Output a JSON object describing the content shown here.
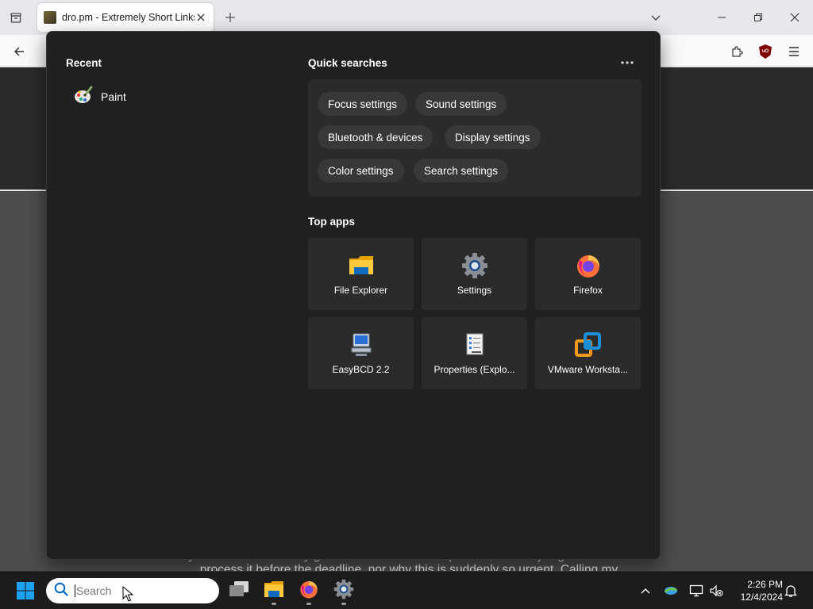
{
  "browser": {
    "tab_title": "dro.pm - Extremely Short Links"
  },
  "page": {
    "text_line1": "says: I do not know if my government will be so expedient, nor if my registrar can then",
    "text_line2": "process it before the deadline, nor why this is suddenly so urgent. Calling my"
  },
  "flyout": {
    "recent_heading": "Recent",
    "recent_items": [
      {
        "label": "Paint",
        "icon": "paint-icon"
      }
    ],
    "quick_heading": "Quick searches",
    "quick_searches": [
      "Focus settings",
      "Sound settings",
      "Bluetooth & devices",
      "Display settings",
      "Color settings",
      "Search settings"
    ],
    "top_apps_heading": "Top apps",
    "top_apps": [
      {
        "label": "File Explorer",
        "icon": "folder-icon"
      },
      {
        "label": "Settings",
        "icon": "gear-icon"
      },
      {
        "label": "Firefox",
        "icon": "firefox-icon"
      },
      {
        "label": "EasyBCD 2.2",
        "icon": "computer-icon"
      },
      {
        "label": "Properties (Explo...",
        "icon": "properties-icon"
      },
      {
        "label": "VMware Worksta...",
        "icon": "vmware-icon"
      }
    ]
  },
  "taskbar": {
    "search_placeholder": "Search",
    "apps": [
      "task-view",
      "file-explorer",
      "firefox",
      "settings"
    ],
    "time": "2:26 PM",
    "date": "12/4/2024"
  },
  "colors": {
    "flyout_bg": "#202020",
    "panel_bg": "#2b2b2b",
    "chip_bg": "#383838",
    "accent": "#0078d4"
  }
}
